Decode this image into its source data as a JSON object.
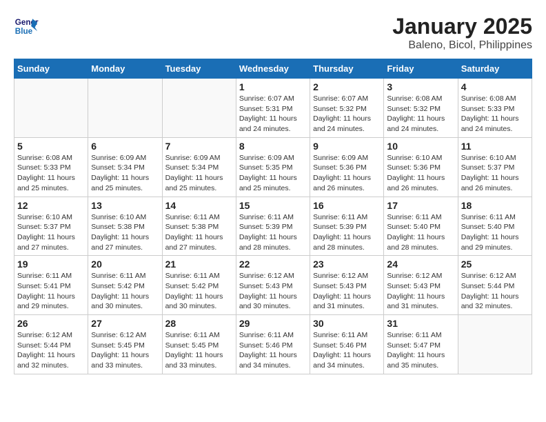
{
  "header": {
    "logo_line1": "General",
    "logo_line2": "Blue",
    "title": "January 2025",
    "subtitle": "Baleno, Bicol, Philippines"
  },
  "calendar": {
    "weekdays": [
      "Sunday",
      "Monday",
      "Tuesday",
      "Wednesday",
      "Thursday",
      "Friday",
      "Saturday"
    ],
    "weeks": [
      [
        {
          "day": "",
          "info": ""
        },
        {
          "day": "",
          "info": ""
        },
        {
          "day": "",
          "info": ""
        },
        {
          "day": "1",
          "info": "Sunrise: 6:07 AM\nSunset: 5:31 PM\nDaylight: 11 hours and 24 minutes."
        },
        {
          "day": "2",
          "info": "Sunrise: 6:07 AM\nSunset: 5:32 PM\nDaylight: 11 hours and 24 minutes."
        },
        {
          "day": "3",
          "info": "Sunrise: 6:08 AM\nSunset: 5:32 PM\nDaylight: 11 hours and 24 minutes."
        },
        {
          "day": "4",
          "info": "Sunrise: 6:08 AM\nSunset: 5:33 PM\nDaylight: 11 hours and 24 minutes."
        }
      ],
      [
        {
          "day": "5",
          "info": "Sunrise: 6:08 AM\nSunset: 5:33 PM\nDaylight: 11 hours and 25 minutes."
        },
        {
          "day": "6",
          "info": "Sunrise: 6:09 AM\nSunset: 5:34 PM\nDaylight: 11 hours and 25 minutes."
        },
        {
          "day": "7",
          "info": "Sunrise: 6:09 AM\nSunset: 5:34 PM\nDaylight: 11 hours and 25 minutes."
        },
        {
          "day": "8",
          "info": "Sunrise: 6:09 AM\nSunset: 5:35 PM\nDaylight: 11 hours and 25 minutes."
        },
        {
          "day": "9",
          "info": "Sunrise: 6:09 AM\nSunset: 5:36 PM\nDaylight: 11 hours and 26 minutes."
        },
        {
          "day": "10",
          "info": "Sunrise: 6:10 AM\nSunset: 5:36 PM\nDaylight: 11 hours and 26 minutes."
        },
        {
          "day": "11",
          "info": "Sunrise: 6:10 AM\nSunset: 5:37 PM\nDaylight: 11 hours and 26 minutes."
        }
      ],
      [
        {
          "day": "12",
          "info": "Sunrise: 6:10 AM\nSunset: 5:37 PM\nDaylight: 11 hours and 27 minutes."
        },
        {
          "day": "13",
          "info": "Sunrise: 6:10 AM\nSunset: 5:38 PM\nDaylight: 11 hours and 27 minutes."
        },
        {
          "day": "14",
          "info": "Sunrise: 6:11 AM\nSunset: 5:38 PM\nDaylight: 11 hours and 27 minutes."
        },
        {
          "day": "15",
          "info": "Sunrise: 6:11 AM\nSunset: 5:39 PM\nDaylight: 11 hours and 28 minutes."
        },
        {
          "day": "16",
          "info": "Sunrise: 6:11 AM\nSunset: 5:39 PM\nDaylight: 11 hours and 28 minutes."
        },
        {
          "day": "17",
          "info": "Sunrise: 6:11 AM\nSunset: 5:40 PM\nDaylight: 11 hours and 28 minutes."
        },
        {
          "day": "18",
          "info": "Sunrise: 6:11 AM\nSunset: 5:40 PM\nDaylight: 11 hours and 29 minutes."
        }
      ],
      [
        {
          "day": "19",
          "info": "Sunrise: 6:11 AM\nSunset: 5:41 PM\nDaylight: 11 hours and 29 minutes."
        },
        {
          "day": "20",
          "info": "Sunrise: 6:11 AM\nSunset: 5:42 PM\nDaylight: 11 hours and 30 minutes."
        },
        {
          "day": "21",
          "info": "Sunrise: 6:11 AM\nSunset: 5:42 PM\nDaylight: 11 hours and 30 minutes."
        },
        {
          "day": "22",
          "info": "Sunrise: 6:12 AM\nSunset: 5:43 PM\nDaylight: 11 hours and 30 minutes."
        },
        {
          "day": "23",
          "info": "Sunrise: 6:12 AM\nSunset: 5:43 PM\nDaylight: 11 hours and 31 minutes."
        },
        {
          "day": "24",
          "info": "Sunrise: 6:12 AM\nSunset: 5:43 PM\nDaylight: 11 hours and 31 minutes."
        },
        {
          "day": "25",
          "info": "Sunrise: 6:12 AM\nSunset: 5:44 PM\nDaylight: 11 hours and 32 minutes."
        }
      ],
      [
        {
          "day": "26",
          "info": "Sunrise: 6:12 AM\nSunset: 5:44 PM\nDaylight: 11 hours and 32 minutes."
        },
        {
          "day": "27",
          "info": "Sunrise: 6:12 AM\nSunset: 5:45 PM\nDaylight: 11 hours and 33 minutes."
        },
        {
          "day": "28",
          "info": "Sunrise: 6:11 AM\nSunset: 5:45 PM\nDaylight: 11 hours and 33 minutes."
        },
        {
          "day": "29",
          "info": "Sunrise: 6:11 AM\nSunset: 5:46 PM\nDaylight: 11 hours and 34 minutes."
        },
        {
          "day": "30",
          "info": "Sunrise: 6:11 AM\nSunset: 5:46 PM\nDaylight: 11 hours and 34 minutes."
        },
        {
          "day": "31",
          "info": "Sunrise: 6:11 AM\nSunset: 5:47 PM\nDaylight: 11 hours and 35 minutes."
        },
        {
          "day": "",
          "info": ""
        }
      ]
    ]
  }
}
